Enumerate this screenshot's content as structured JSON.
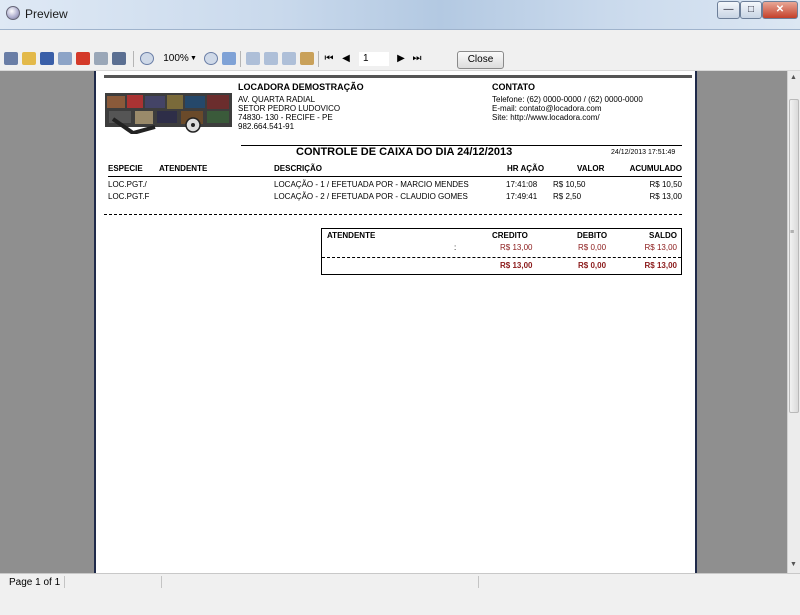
{
  "window": {
    "title": "Preview",
    "min": "—",
    "max": "□",
    "close": "✕"
  },
  "toolbar": {
    "zoom": "100%",
    "page_number": "1",
    "close_label": "Close"
  },
  "report": {
    "company": {
      "name": "LOCADORA DEMOSTRAÇÃO",
      "lines": [
        "AV. QUARTA RADIAL",
        "SETOR PEDRO LUDOVICO",
        "74830- 130 - RECIFE - PE",
        "982.664.541-91"
      ]
    },
    "contact": {
      "title": "CONTATO",
      "phone": "Telefone: (62) 0000-0000 / (62) 0000-0000",
      "email": "E-mail: contato@locadora.com",
      "site": "Site: http://www.locadora.com/"
    },
    "title": "CONTROLE DE CAIXA DO DIA 24/12/2013",
    "printed_at": "24/12/2013 17:51:49",
    "columns": {
      "especie": "ESPECIE",
      "atendente": "ATENDENTE",
      "descricao": "DESCRIÇÃO",
      "hr_acao": "HR AÇÃO",
      "valor": "VALOR",
      "acumulado": "ACUMULADO"
    },
    "rows": [
      {
        "especie": "LOC.PGT./",
        "atendente": "",
        "descricao": "LOCAÇÃO - 1 / EFETUADA POR - MARCIO MENDES",
        "hr_acao": "17:41:08",
        "valor": "R$ 10,50",
        "acumulado": "R$ 10,50"
      },
      {
        "especie": "LOC.PGT.F",
        "atendente": "",
        "descricao": "LOCAÇÃO - 2 / EFETUADA POR - CLAUDIO GOMES",
        "hr_acao": "17:49:41",
        "valor": "R$ 2,50",
        "acumulado": "R$ 13,00"
      }
    ],
    "summary": {
      "headers": {
        "atendente": "ATENDENTE",
        "credito": "CREDITO",
        "debito": "DEBITO",
        "saldo": "SALDO"
      },
      "row": {
        "atendente": ":",
        "credito": "R$ 13,00",
        "debito": "R$ 0,00",
        "saldo": "R$ 13,00"
      },
      "total": {
        "credito": "R$ 13,00",
        "debito": "R$ 0,00",
        "saldo": "R$ 13,00"
      }
    }
  },
  "status": {
    "page_info": "Page 1 of 1"
  }
}
